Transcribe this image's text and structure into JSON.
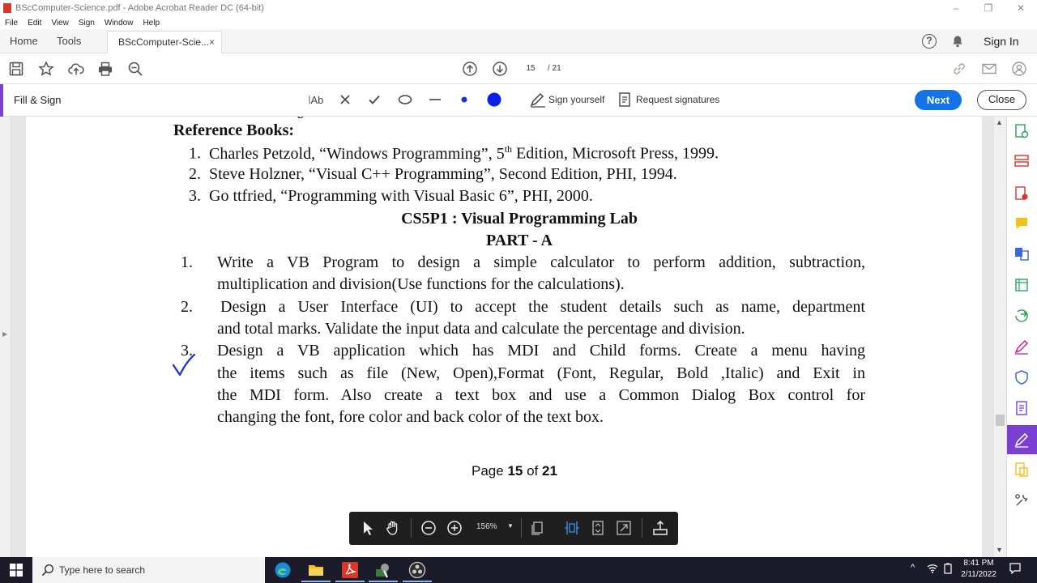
{
  "window": {
    "title": "BScComputer-Science.pdf - Adobe Acrobat Reader DC (64-bit)",
    "controls": [
      "–",
      "❐",
      "✕"
    ]
  },
  "menu": [
    "File",
    "Edit",
    "View",
    "Sign",
    "Window",
    "Help"
  ],
  "tabs": {
    "home": "Home",
    "tools": "Tools",
    "document": "BScComputer-Scie...",
    "close": "×",
    "help": "?",
    "sign_in": "Sign In"
  },
  "toolbar": {
    "page_current": "15",
    "page_total": "/ 21"
  },
  "fill_sign": {
    "label": "Fill & Sign",
    "text_tool": "Ab",
    "sign_yourself": "Sign yourself",
    "request_signatures": "Request signatures",
    "next": "Next",
    "close": "Close",
    "accent_color": "#1473e6",
    "active_color": "#7b3fd6"
  },
  "document": {
    "heading_reference": "Reference Books:",
    "refs": [
      {
        "num": "1.",
        "pre": "Charles Petzold, “Windows Programming”, 5",
        "sup": "th",
        "post": " Edition, Microsoft Press, 1999."
      },
      {
        "num": "2.",
        "text": "Steve Holzner, “Visual C++ Programming”, Second Edition, PHI, 1994."
      },
      {
        "num": "3.",
        "text": "Go ttfried, “Programming with Visual Basic 6”, PHI, 2000."
      }
    ],
    "lab_title": "CS5P1 : Visual Programming Lab",
    "part_title": "PART - A",
    "items": [
      {
        "num": "1.",
        "lines": [
          "Write a VB Program to design a simple calculator to perform addition, subtraction,",
          "multiplication and division(Use functions for the calculations)."
        ]
      },
      {
        "num": "2.",
        "lines": [
          "Design a User Interface (UI) to accept the student details such as name, department",
          "and total marks. Validate the input data and calculate the percentage and division."
        ]
      },
      {
        "num": "3.",
        "lines": [
          "Design a VB application which has MDI and Child forms. Create a menu having",
          "the items such as file (New, Open),Format (Font, Regular, Bold ,Italic) and Exit in",
          "the MDI form. Also create a text box and use a Common Dialog Box control for",
          "changing the font, fore color and back color of the text box."
        ]
      }
    ],
    "footer": {
      "page_word": "Page",
      "page_num": "15",
      "of_word": "of",
      "total": "21"
    },
    "check_color": "#1a2fd6"
  },
  "floating_toolbar": {
    "zoom": "156%"
  },
  "taskbar": {
    "search_placeholder": "Type here to search",
    "time": "8:41 PM",
    "date": "2/11/2022"
  }
}
